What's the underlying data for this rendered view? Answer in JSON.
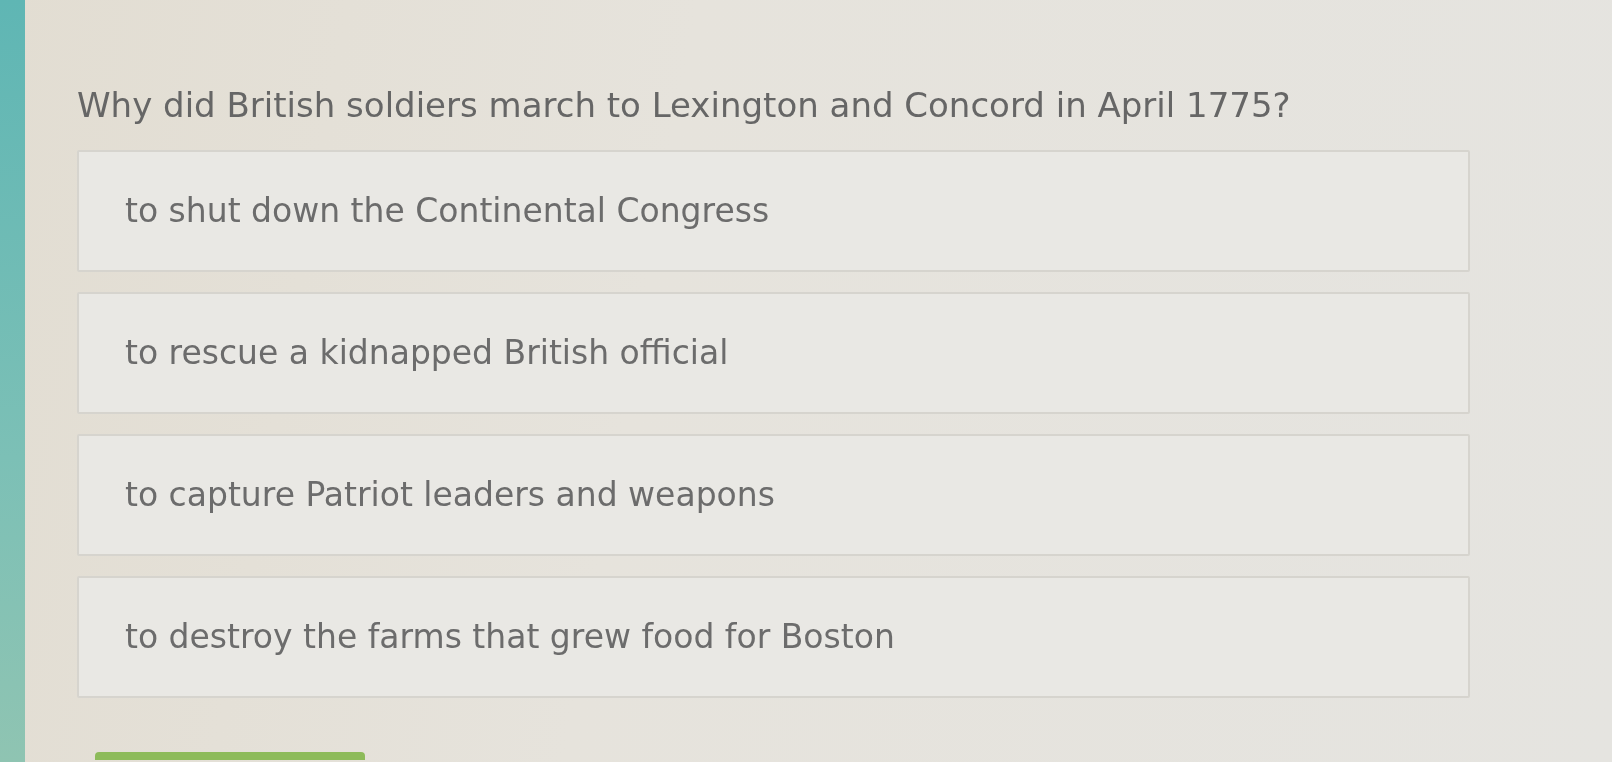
{
  "question": {
    "text": "Why did British soldiers march to Lexington and Concord in April 1775?"
  },
  "choices": [
    {
      "text": "to shut down the Continental Congress",
      "selected": false
    },
    {
      "text": "to rescue a kidnapped British official",
      "selected": false
    },
    {
      "text": "to capture Patriot leaders and weapons",
      "selected": false
    },
    {
      "text": "to destroy the farms that grew food for Boston",
      "selected": false
    }
  ]
}
